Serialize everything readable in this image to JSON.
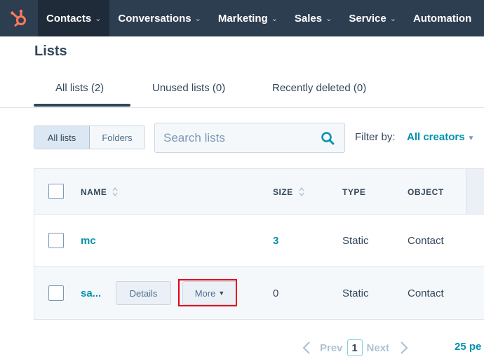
{
  "nav": {
    "items": [
      {
        "label": "Contacts",
        "has_chevron": true,
        "active": true
      },
      {
        "label": "Conversations",
        "has_chevron": true
      },
      {
        "label": "Marketing",
        "has_chevron": true
      },
      {
        "label": "Sales",
        "has_chevron": true
      },
      {
        "label": "Service",
        "has_chevron": true
      },
      {
        "label": "Automation",
        "has_chevron": false
      }
    ],
    "chevron": "⌄"
  },
  "page": {
    "title": "Lists"
  },
  "tabs": [
    {
      "label": "All lists (2)",
      "active": true
    },
    {
      "label": "Unused lists (0)"
    },
    {
      "label": "Recently deleted (0)"
    }
  ],
  "toolbar": {
    "view_toggle": [
      "All lists",
      "Folders"
    ],
    "search_placeholder": "Search lists",
    "filter_label": "Filter by:",
    "filter_value": "All creators"
  },
  "table": {
    "headers": {
      "name": "NAME",
      "size": "SIZE",
      "type": "TYPE",
      "object": "OBJECT"
    },
    "rows": [
      {
        "name": "mc",
        "size": "3",
        "type": "Static",
        "object": "Contact"
      },
      {
        "name": "sa...",
        "size": "0",
        "type": "Static",
        "object": "Contact",
        "details_label": "Details",
        "more_label": "More"
      }
    ]
  },
  "pagination": {
    "prev": "Prev",
    "current": "1",
    "next": "Next",
    "per_page": "25 pe"
  },
  "colors": {
    "nav_bg": "#2d3e50",
    "accent": "#0091ae",
    "logo": "#ff7a59",
    "highlight": "#e3001b"
  }
}
